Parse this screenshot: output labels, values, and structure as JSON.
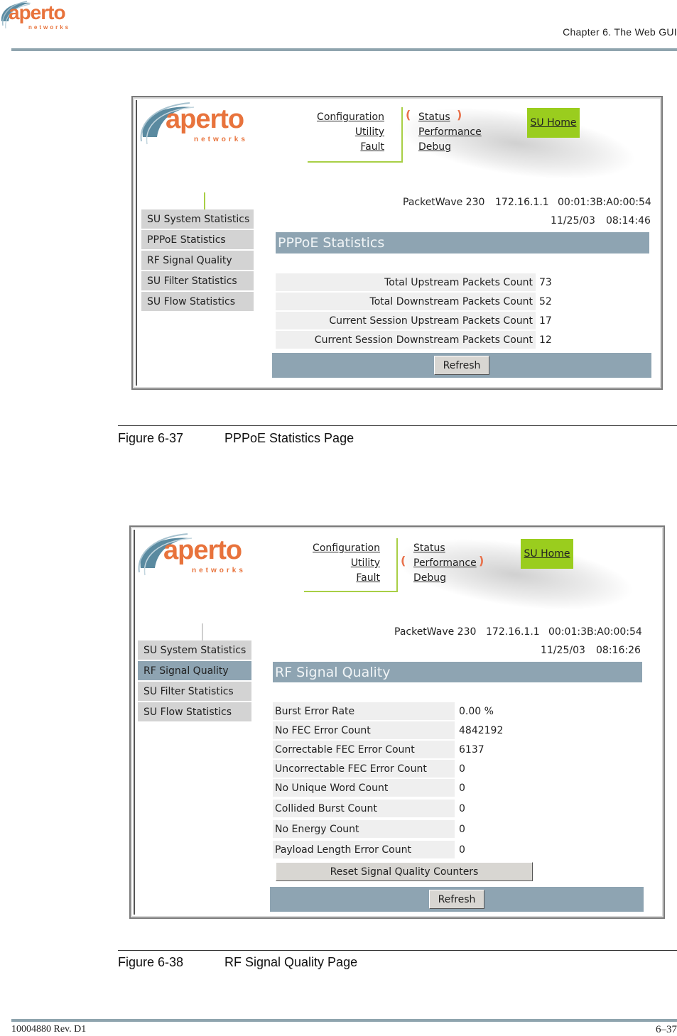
{
  "page_header": {
    "logo_word": "aperto",
    "logo_sub": "networks",
    "chapter": "Chapter 6.  The Web GUI"
  },
  "figures": [
    {
      "caption_number": "Figure 6-37",
      "caption_title": "PPPoE Statistics Page",
      "screenshot": {
        "logo_word": "aperto",
        "logo_sub": "networks",
        "nav_left": [
          "Configuration",
          "Utility",
          "Fault"
        ],
        "nav_right": [
          "Status",
          "Performance",
          "Debug"
        ],
        "nav_right_selected": "Status",
        "home_button": "SU Home",
        "device": "PacketWave 230",
        "ip": "172.16.1.1",
        "mac": "00:01:3B:A0:00:54",
        "date": "11/25/03",
        "time": "08:14:46",
        "sidebar": [
          "SU System Statistics",
          "PPPoE Statistics",
          "RF Signal Quality",
          "SU Filter Statistics",
          "SU Flow Statistics"
        ],
        "sidebar_active": "PPPoE Statistics",
        "panel_title": "PPPoE Statistics",
        "stats": [
          {
            "label": "Total Upstream Packets Count",
            "value": "73"
          },
          {
            "label": "Total Downstream Packets Count",
            "value": "52"
          },
          {
            "label": "Current Session Upstream Packets Count",
            "value": "17"
          },
          {
            "label": "Current Session Downstream Packets Count",
            "value": "12"
          }
        ],
        "refresh_label": "Refresh"
      }
    },
    {
      "caption_number": "Figure 6-38",
      "caption_title": "RF Signal Quality Page",
      "screenshot": {
        "logo_word": "aperto",
        "logo_sub": "networks",
        "nav_left": [
          "Configuration",
          "Utility",
          "Fault"
        ],
        "nav_right": [
          "Status",
          "Performance",
          "Debug"
        ],
        "nav_right_selected": "Performance",
        "home_button": "SU Home",
        "device": "PacketWave 230",
        "ip": "172.16.1.1",
        "mac": "00:01:3B:A0:00:54",
        "date": "11/25/03",
        "time": "08:16:26",
        "sidebar": [
          "SU System Statistics",
          "RF Signal Quality",
          "SU Filter Statistics",
          "SU Flow Statistics"
        ],
        "sidebar_active": "RF Signal Quality",
        "panel_title": "RF Signal Quality",
        "stats": [
          {
            "label": "Burst Error Rate",
            "value": "0.00 %"
          },
          {
            "label": "No FEC Error Count",
            "value": "4842192"
          },
          {
            "label": "Correctable FEC Error Count",
            "value": "6137"
          },
          {
            "label": "Uncorrectable FEC Error Count",
            "value": "0"
          },
          {
            "label": "No Unique Word Count",
            "value": "0"
          },
          {
            "label": "Collided Burst Count",
            "value": "0"
          },
          {
            "label": "No Energy Count",
            "value": "0"
          },
          {
            "label": "Payload Length Error Count",
            "value": "0"
          }
        ],
        "reset_label": "Reset Signal Quality Counters",
        "refresh_label": "Refresh"
      }
    }
  ],
  "page_footer": {
    "doc_id": "10004880 Rev. D1",
    "page_number": "6–37"
  },
  "colors": {
    "brand_orange": "#e8733c",
    "brand_blue": "#5a8aa0",
    "nav_green": "#9acd1e",
    "panel_blue": "#8ea4b2",
    "sidebar_gray": "#d3d3d3"
  }
}
